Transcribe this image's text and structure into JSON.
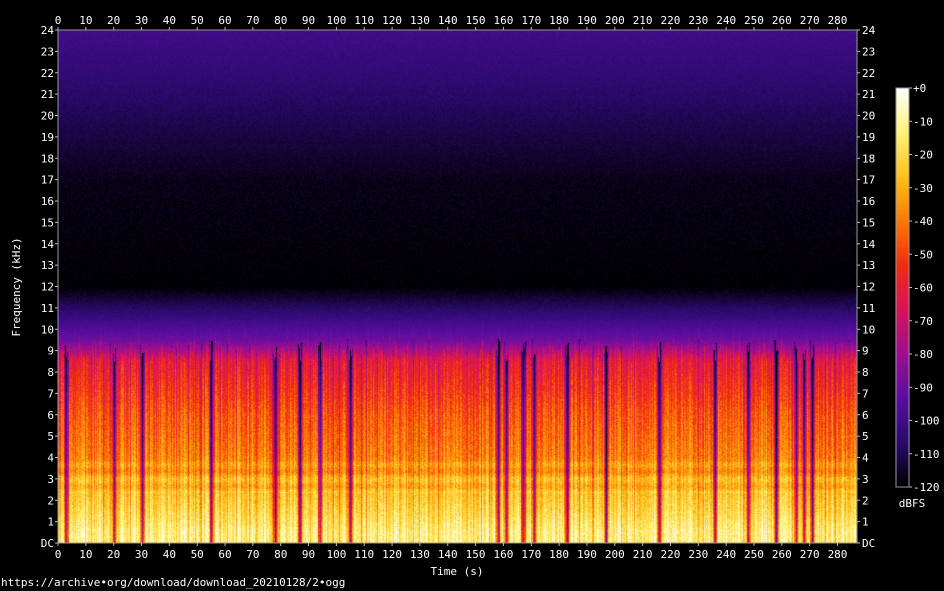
{
  "footer": {
    "source": "https://archive•org/download/download_20210128/2•ogg"
  },
  "chart_data": {
    "type": "heatmap",
    "title": "",
    "xlabel": "Time (s)",
    "ylabel": "Frequency (kHz)",
    "xlim": [
      0,
      287
    ],
    "ylim": [
      0,
      24
    ],
    "x_ticks": [
      0,
      10,
      20,
      30,
      40,
      50,
      60,
      70,
      80,
      90,
      100,
      110,
      120,
      130,
      140,
      150,
      160,
      170,
      180,
      190,
      200,
      210,
      220,
      230,
      240,
      250,
      260,
      270,
      280
    ],
    "y_ticks": [
      "DC",
      "1",
      "2",
      "3",
      "4",
      "5",
      "6",
      "7",
      "8",
      "9",
      "10",
      "11",
      "12",
      "13",
      "14",
      "15",
      "16",
      "17",
      "18",
      "19",
      "20",
      "21",
      "22",
      "23",
      "24"
    ],
    "colorbar": {
      "label": "dBFS",
      "range": [
        -120,
        0
      ],
      "ticks": [
        "+0",
        "-10",
        "-20",
        "-30",
        "-40",
        "-50",
        "-60",
        "-70",
        "-80",
        "-90",
        "-100",
        "-110",
        "-120"
      ],
      "colors": [
        "#000000",
        "#2b0a6e",
        "#5a0ea0",
        "#9c0f90",
        "#d8135a",
        "#f32b14",
        "#fb7a05",
        "#ffc21a",
        "#fff27a",
        "#ffffff"
      ]
    },
    "dropouts_s": [
      3,
      20,
      30,
      55,
      78,
      87,
      94,
      105,
      158,
      161,
      167,
      171,
      183,
      197,
      216,
      236,
      248,
      258,
      265,
      268,
      271
    ],
    "energy_profile": [
      {
        "khz": 0.5,
        "db": -12
      },
      {
        "khz": 1.5,
        "db": -20
      },
      {
        "khz": 2.7,
        "db": -27
      },
      {
        "khz": 4.0,
        "db": -38
      },
      {
        "khz": 6.0,
        "db": -45
      },
      {
        "khz": 8.5,
        "db": -60
      },
      {
        "khz": 9.5,
        "db": -85
      },
      {
        "khz": 12.0,
        "db": -115
      },
      {
        "khz": 17.0,
        "db": -112
      },
      {
        "khz": 24.0,
        "db": -95
      }
    ]
  }
}
